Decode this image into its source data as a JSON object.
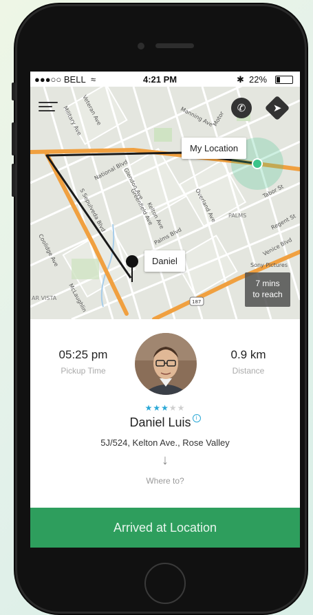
{
  "status_bar": {
    "carrier": "●●●○○ BELL",
    "time": "4:21 PM",
    "battery": "22%"
  },
  "map": {
    "my_location_label": "My Location",
    "driver_label": "Daniel",
    "eta": "7 mins",
    "eta_suffix": "to reach",
    "street_names": {
      "national": "National Blvd",
      "palms": "Palms Blvd",
      "overland": "Overland Ave",
      "palms_area": "PALMS",
      "sony": "Sony Pictures",
      "venice": "Venice Blvd",
      "sepulveda": "S Sepulveda Blvd",
      "mar_vista": "AR VISTA",
      "mclaughlin": "McLaughlin",
      "greenfield": "Greenfield Ave",
      "kelton": "Kelton Ave",
      "military": "Military Ave",
      "veteran": "Veteran Ave",
      "motor": "Motor",
      "regent": "Regent St",
      "tabor": "Tabor St",
      "manning": "Manning Ave",
      "coolidge": "Coolidge Ave",
      "glendon": "Glendon Ave",
      "route": "187"
    },
    "colors": {
      "route": "#1a1a1a",
      "highway": "#f0a040",
      "destination": "#3bc48a"
    }
  },
  "trip": {
    "pickup_time": "05:25 pm",
    "pickup_time_label": "Pickup Time",
    "distance": "0.9 km",
    "distance_label": "Distance",
    "rating_filled": "★★★",
    "rating_empty": "★★",
    "rating": 3,
    "rating_max": 5,
    "passenger_name": "Daniel Luis",
    "address": "5J/524, Kelton Ave., Rose Valley",
    "where_to": "Where to?"
  },
  "actions": {
    "arrived_label": "Arrived at Location"
  },
  "icons": [
    "menu-icon",
    "phone-icon",
    "directions-icon",
    "info-icon",
    "arrow-down-icon",
    "pin-icon",
    "location-dot-icon"
  ]
}
